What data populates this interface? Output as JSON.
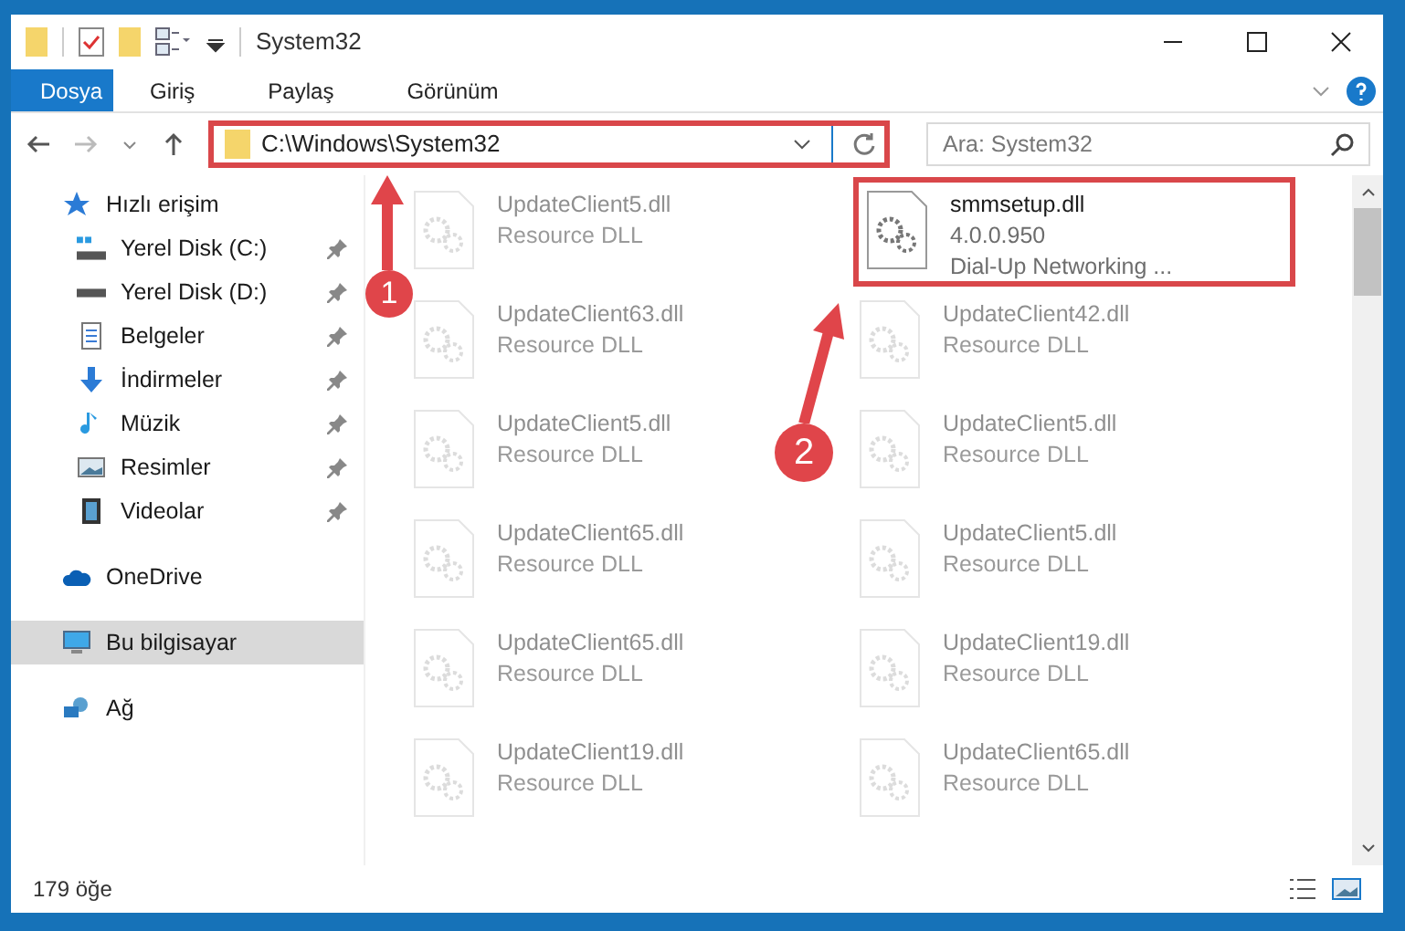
{
  "window": {
    "title": "System32"
  },
  "tabs": [
    {
      "label": "Dosya",
      "selected": true
    },
    {
      "label": "Giriş",
      "selected": false
    },
    {
      "label": "Paylaş",
      "selected": false
    },
    {
      "label": "Görünüm",
      "selected": false
    }
  ],
  "address": {
    "path": "C:\\Windows\\System32",
    "highlighted": true
  },
  "search": {
    "placeholder": "Ara: System32"
  },
  "sidebar": {
    "items": [
      {
        "label": "Hızlı erişim",
        "kind": "star",
        "selected": false,
        "children": [
          {
            "label": "Yerel Disk (C:)",
            "kind": "drive-c",
            "pinned": true
          },
          {
            "label": "Yerel Disk (D:)",
            "kind": "drive",
            "pinned": true
          },
          {
            "label": "Belgeler",
            "kind": "docs",
            "pinned": true
          },
          {
            "label": "İndirmeler",
            "kind": "download",
            "pinned": true
          },
          {
            "label": "Müzik",
            "kind": "music",
            "pinned": true
          },
          {
            "label": "Resimler",
            "kind": "pictures",
            "pinned": true
          },
          {
            "label": "Videolar",
            "kind": "videos",
            "pinned": true
          }
        ]
      },
      {
        "label": "OneDrive",
        "kind": "cloud",
        "selected": false
      },
      {
        "label": "Bu bilgisayar",
        "kind": "pc",
        "selected": true
      },
      {
        "label": "Ağ",
        "kind": "network",
        "selected": false
      }
    ]
  },
  "files": [
    {
      "name": "UpdateClient5.dll",
      "lines": [
        "Resource DLL"
      ],
      "faded": true,
      "highlighted": false
    },
    {
      "name": "smmsetup.dll",
      "lines": [
        "4.0.0.950",
        "Dial-Up Networking ..."
      ],
      "faded": false,
      "highlighted": true
    },
    {
      "name": "UpdateClient63.dll",
      "lines": [
        "Resource DLL"
      ],
      "faded": true,
      "highlighted": false
    },
    {
      "name": "UpdateClient42.dll",
      "lines": [
        "Resource DLL"
      ],
      "faded": true,
      "highlighted": false
    },
    {
      "name": "UpdateClient5.dll",
      "lines": [
        "Resource DLL"
      ],
      "faded": true,
      "highlighted": false
    },
    {
      "name": "UpdateClient5.dll",
      "lines": [
        "Resource DLL"
      ],
      "faded": true,
      "highlighted": false
    },
    {
      "name": "UpdateClient65.dll",
      "lines": [
        "Resource DLL"
      ],
      "faded": true,
      "highlighted": false
    },
    {
      "name": "UpdateClient5.dll",
      "lines": [
        "Resource DLL"
      ],
      "faded": true,
      "highlighted": false
    },
    {
      "name": "UpdateClient65.dll",
      "lines": [
        "Resource DLL"
      ],
      "faded": true,
      "highlighted": false
    },
    {
      "name": "UpdateClient19.dll",
      "lines": [
        "Resource DLL"
      ],
      "faded": true,
      "highlighted": false
    },
    {
      "name": "UpdateClient19.dll",
      "lines": [
        "Resource DLL"
      ],
      "faded": true,
      "highlighted": false
    },
    {
      "name": "UpdateClient65.dll",
      "lines": [
        "Resource DLL"
      ],
      "faded": true,
      "highlighted": false
    }
  ],
  "status_bar": {
    "count": "179 öğe"
  },
  "annotations": [
    {
      "number": "1"
    },
    {
      "number": "2"
    }
  ]
}
